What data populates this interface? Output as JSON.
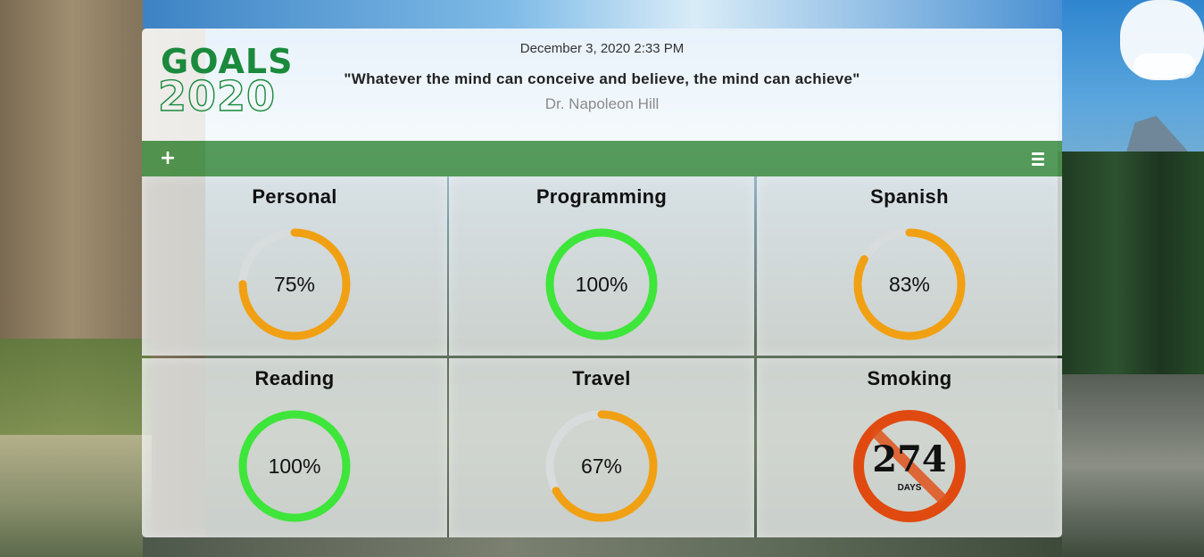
{
  "header": {
    "logo_top": "GOALS",
    "logo_bottom": "2020",
    "datetime": "December 3, 2020 2:33 PM",
    "quote": "\"Whatever the mind can conceive and believe, the mind can achieve\"",
    "author": "Dr. Napoleon Hill"
  },
  "toolbar": {
    "add_label": "+",
    "add_icon": "plus-icon",
    "menu_icon": "hamburger-menu-icon"
  },
  "colors": {
    "brand_green": "#1b8a3d",
    "toolbar_green": "#4c964c",
    "progress_complete": "#3ee53a",
    "progress_partial": "#f0a012",
    "progress_track": "#d9dcdc",
    "quit_red": "#e04a10"
  },
  "goals": [
    {
      "title": "Personal",
      "percent": 75,
      "label": "75%",
      "status": "partial"
    },
    {
      "title": "Programming",
      "percent": 100,
      "label": "100%",
      "status": "complete"
    },
    {
      "title": "Spanish",
      "percent": 83,
      "label": "83%",
      "status": "partial"
    },
    {
      "title": "Reading",
      "percent": 100,
      "label": "100%",
      "status": "complete"
    },
    {
      "title": "Travel",
      "percent": 67,
      "label": "67%",
      "status": "partial"
    },
    {
      "title": "Smoking",
      "days": "274",
      "days_label": "DAYS",
      "icon": "no-smoking-icon",
      "status": "quit"
    }
  ]
}
